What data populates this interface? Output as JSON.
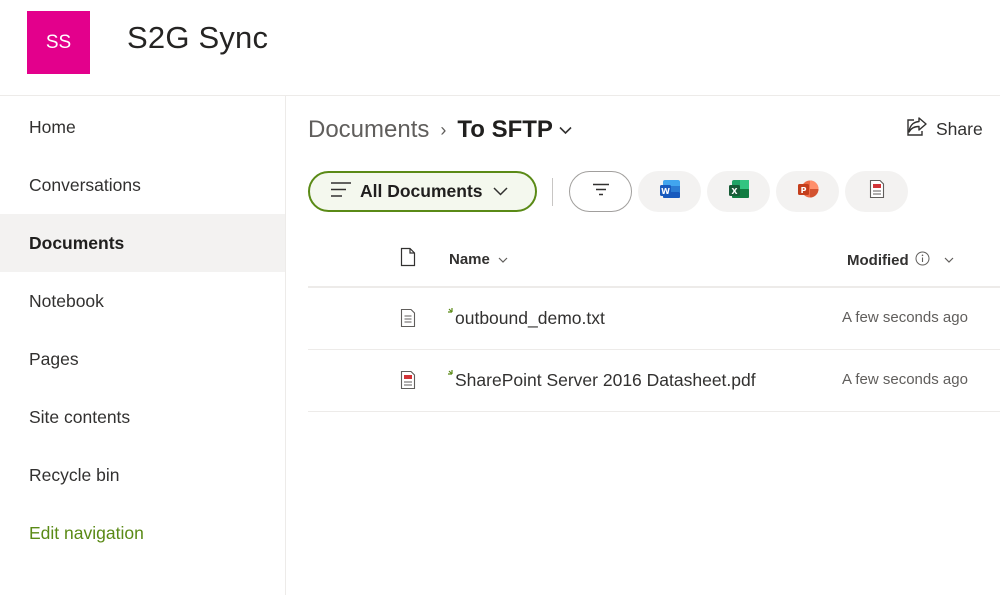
{
  "site": {
    "logo_initials": "SS",
    "title": "S2G Sync",
    "logo_color": "#e3008c"
  },
  "nav": {
    "items": [
      {
        "label": "Home"
      },
      {
        "label": "Conversations"
      },
      {
        "label": "Documents",
        "active": true
      },
      {
        "label": "Notebook"
      },
      {
        "label": "Pages"
      },
      {
        "label": "Site contents"
      },
      {
        "label": "Recycle bin"
      }
    ],
    "edit_label": "Edit navigation"
  },
  "breadcrumb": {
    "root": "Documents",
    "current": "To SFTP"
  },
  "actions": {
    "share_label": "Share"
  },
  "toolbar": {
    "view_label": "All Documents",
    "icons": [
      "filter-icon",
      "word-icon",
      "excel-icon",
      "powerpoint-icon",
      "pdf-icon"
    ]
  },
  "table": {
    "columns": {
      "type": "",
      "name": "Name",
      "modified": "Modified"
    },
    "rows": [
      {
        "name": "outbound_demo.txt",
        "modified": "A few seconds ago",
        "type_icon": "text-file-icon"
      },
      {
        "name": "SharePoint Server 2016 Datasheet.pdf",
        "modified": "A few seconds ago",
        "type_icon": "pdf-file-icon"
      }
    ]
  },
  "colors": {
    "accent": "#5a8a16",
    "nav_active_bg": "#f3f2f1"
  }
}
